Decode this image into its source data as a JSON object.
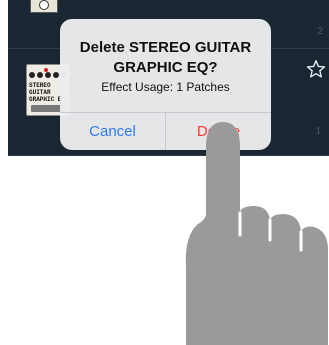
{
  "list": {
    "row_top_count": "2",
    "row_mid_count": "1"
  },
  "pedal": {
    "brand_text": "STEREO\nGUITAR\nGRAPHIC EQ"
  },
  "dialog": {
    "title": "Delete STEREO GUITAR GRAPHIC EQ?",
    "message": "Effect Usage: 1 Patches",
    "cancel_label": "Cancel",
    "delete_label": "Delete"
  },
  "colors": {
    "screen_bg": "#1b2633",
    "dialog_bg": "#ececee",
    "cancel_blue": "#2f7bf6",
    "delete_red": "#ff3b30",
    "hand_gray": "#9a9a9a"
  },
  "icons": [
    "star-icon",
    "pointing-hand-icon"
  ]
}
